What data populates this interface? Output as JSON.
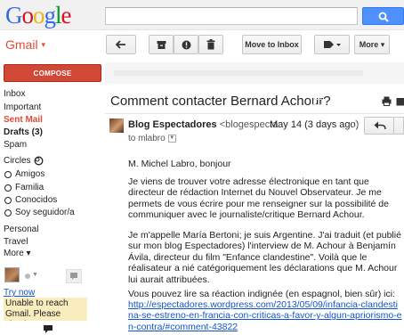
{
  "header": {
    "logo_letters": [
      "G",
      "o",
      "o",
      "g",
      "l",
      "e"
    ],
    "logo_colors": [
      "#3369e8",
      "#d50f25",
      "#eeb211",
      "#3369e8",
      "#009925",
      "#d50f25"
    ],
    "search_placeholder": ""
  },
  "app": {
    "name": "Gmail",
    "caret": "▾"
  },
  "toolbar": {
    "move_to_inbox": "Move to Inbox",
    "more": "More ▾"
  },
  "compose": {
    "label": "COMPOSE"
  },
  "sidebar": {
    "inbox": "Inbox",
    "important": "Important",
    "sent_mail": "Sent Mail",
    "drafts": "Drafts (3)",
    "spam": "Spam",
    "circles": "Circles",
    "circle_items": [
      "Amigos",
      "Familia",
      "Conocidos",
      "Soy seguidor/a"
    ],
    "personal": "Personal",
    "travel": "Travel",
    "more": "More ▾"
  },
  "chat": {
    "try_now": "Try now",
    "warning": "Unable to reach Gmail. Please check"
  },
  "message": {
    "subject": "Comment contacter Bernard Achour?",
    "sender_name": "Blog Espectadores",
    "sender_email": "<blogespecta",
    "date": "May 14 (3 days ago)",
    "to": "to mlabro",
    "greeting": "M. Michel Labro, bonjour",
    "p1": "Je viens de trouver votre adresse électronique en tant que directeur de rédaction Internet du Nouvel Observateur. Je me permets de vous écrire pour me renseigner sur la possibilité de communiquer avec le journaliste/critique Bernard Achour.",
    "p2": "Je m'appelle María Bertoni; je suis Argentine. J'ai traduit (et publié sur mon blog Espectadores) l'interview de M. Achour à Benjamín Ávila, directeur du film \"Enfance clandestine\". Voilà que le réalisateur a nié catégoriquement les déclarations que M. Achour lui aurait attribuées.",
    "p3": "Vous pouvez lire sa réaction indignée (en espagnol, bien sûr) ici:",
    "link": "http://espectadores.wordpress.com/2013/05/09/infancia-clandestina-se-estreno-en-francia-con-criticas-a-favor-y-algun-apriorismo-en-contra/#comment-43822"
  }
}
